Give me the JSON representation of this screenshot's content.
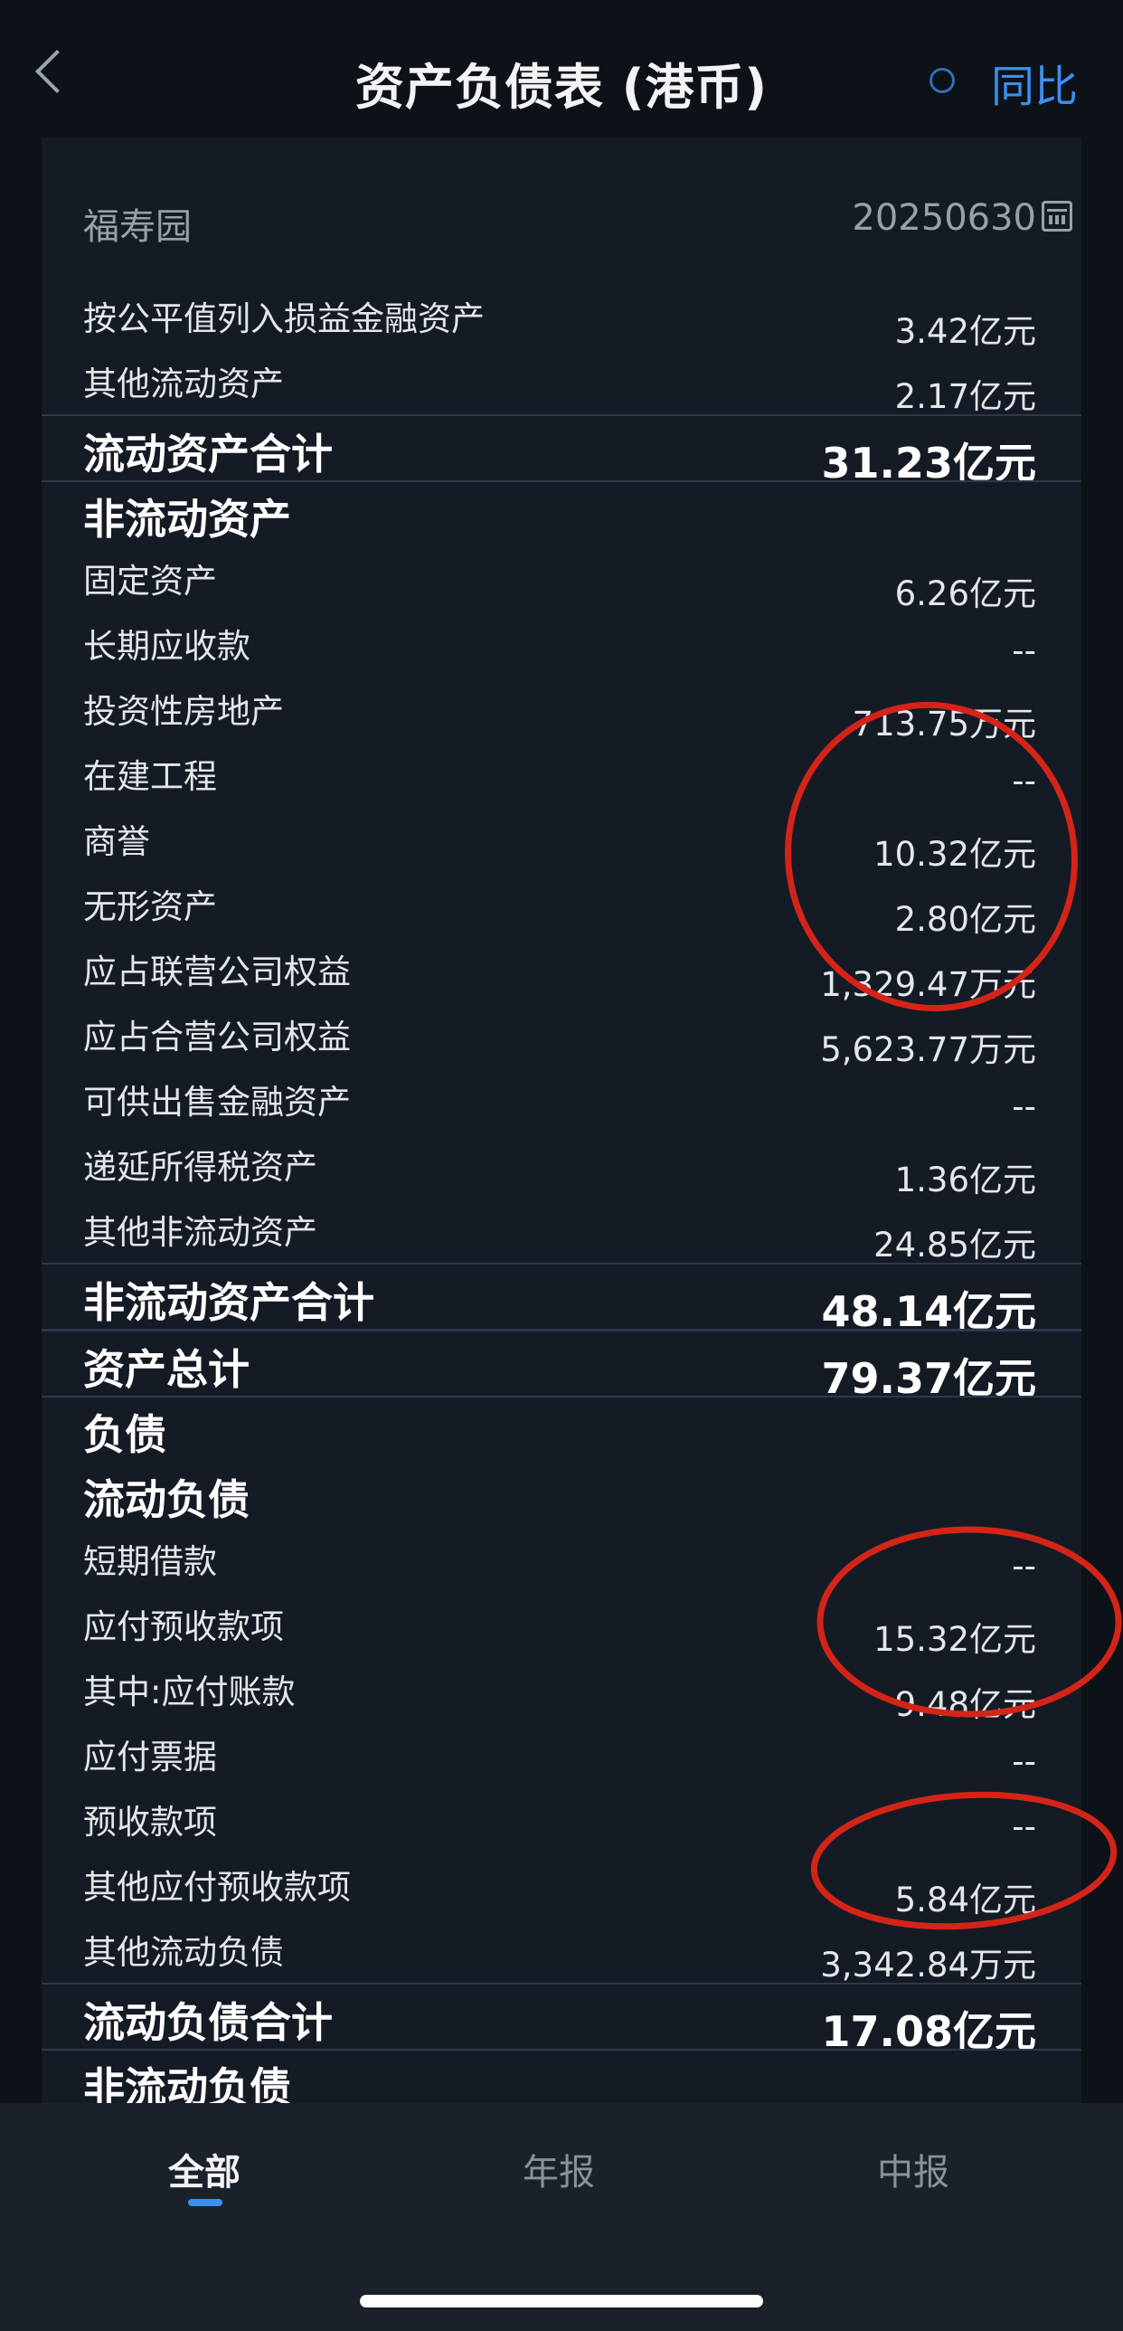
{
  "header": {
    "title": "资产负债表 (港币)",
    "yoy_label": "同比"
  },
  "info": {
    "company": "福寿园",
    "date": "20250630"
  },
  "rows": [
    {
      "label": "按公平值列入损益金融资产",
      "value": "3.42亿元",
      "style": "item"
    },
    {
      "label": "其他流动资产",
      "value": "2.17亿元",
      "style": "item"
    },
    {
      "label": "流动资产合计",
      "value": "31.23亿元",
      "style": "total"
    },
    {
      "label": "非流动资产",
      "value": "",
      "style": "section"
    },
    {
      "label": "固定资产",
      "value": "6.26亿元",
      "style": "item"
    },
    {
      "label": "长期应收款",
      "value": "--",
      "style": "item"
    },
    {
      "label": "投资性房地产",
      "value": "713.75万元",
      "style": "item"
    },
    {
      "label": "在建工程",
      "value": "--",
      "style": "item"
    },
    {
      "label": "商誉",
      "value": "10.32亿元",
      "style": "item"
    },
    {
      "label": "无形资产",
      "value": "2.80亿元",
      "style": "item"
    },
    {
      "label": "应占联营公司权益",
      "value": "1,329.47万元",
      "style": "item"
    },
    {
      "label": "应占合营公司权益",
      "value": "5,623.77万元",
      "style": "item"
    },
    {
      "label": "可供出售金融资产",
      "value": "--",
      "style": "item"
    },
    {
      "label": "递延所得税资产",
      "value": "1.36亿元",
      "style": "item"
    },
    {
      "label": "其他非流动资产",
      "value": "24.85亿元",
      "style": "item"
    },
    {
      "label": "非流动资产合计",
      "value": "48.14亿元",
      "style": "total"
    },
    {
      "label": "资产总计",
      "value": "79.37亿元",
      "style": "total"
    },
    {
      "label": "负债",
      "value": "",
      "style": "section"
    },
    {
      "label": "流动负债",
      "value": "",
      "style": "section"
    },
    {
      "label": "短期借款",
      "value": "--",
      "style": "item"
    },
    {
      "label": "应付预收款项",
      "value": "15.32亿元",
      "style": "item"
    },
    {
      "label": "其中:应付账款",
      "value": "9.48亿元",
      "style": "item"
    },
    {
      "label": "应付票据",
      "value": "--",
      "style": "item"
    },
    {
      "label": "预收款项",
      "value": "--",
      "style": "item"
    },
    {
      "label": "其他应付预收款项",
      "value": "5.84亿元",
      "style": "item"
    },
    {
      "label": "其他流动负债",
      "value": "3,342.84万元",
      "style": "item"
    },
    {
      "label": "流动负债合计",
      "value": "17.08亿元",
      "style": "total"
    },
    {
      "label": "非流动负债",
      "value": "",
      "style": "section"
    }
  ],
  "tabs": [
    {
      "label": "全部",
      "active": true
    },
    {
      "label": "年报",
      "active": false
    },
    {
      "label": "中报",
      "active": false
    }
  ],
  "colors": {
    "accent": "#3b8ff0",
    "annotation": "#d42418",
    "background": "#151b24"
  }
}
